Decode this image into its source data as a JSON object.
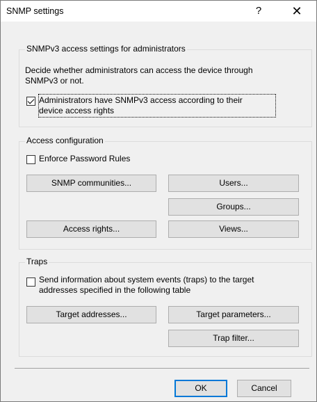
{
  "window": {
    "title": "SNMP settings",
    "help": "?",
    "close": "✕"
  },
  "snmpv3": {
    "legend": "SNMPv3 access settings for administrators",
    "description_line1": "Decide whether administrators can access the device through",
    "description_line2": "SNMPv3 or not.",
    "checkbox_line1": "Administrators have SNMPv3 access according to their",
    "checkbox_line2": "device access rights",
    "checked": true
  },
  "access": {
    "legend": "Access configuration",
    "enforce_label": "Enforce Password Rules",
    "buttons": {
      "snmp_communities": "SNMP communities...",
      "users": "Users...",
      "groups": "Groups...",
      "access_rights": "Access rights...",
      "views": "Views..."
    }
  },
  "traps": {
    "legend": "Traps",
    "checkbox_line1": "Send information about system events (traps) to the target",
    "checkbox_line2": "addresses specified in the following table",
    "buttons": {
      "target_addresses": "Target addresses...",
      "target_parameters": "Target parameters...",
      "trap_filter": "Trap filter..."
    }
  },
  "footer": {
    "ok": "OK",
    "cancel": "Cancel"
  }
}
